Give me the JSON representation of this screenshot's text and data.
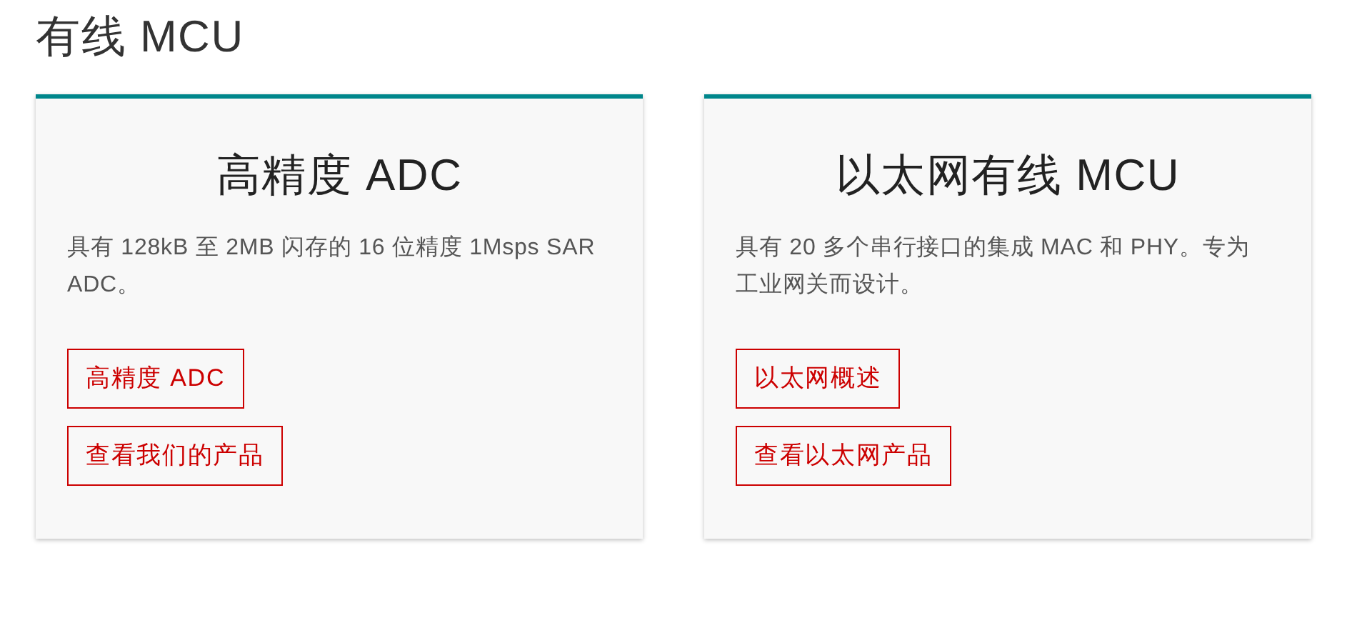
{
  "title": "有线 MCU",
  "cards": [
    {
      "title": "高精度 ADC",
      "description": "具有 128kB 至 2MB 闪存的 16 位精度 1Msps SAR ADC。",
      "buttons": [
        "高精度 ADC",
        "查看我们的产品"
      ]
    },
    {
      "title": "以太网有线 MCU",
      "description": "具有 20 多个串行接口的集成 MAC 和 PHY。专为工业网关而设计。",
      "buttons": [
        "以太网概述",
        "查看以太网产品"
      ]
    }
  ]
}
